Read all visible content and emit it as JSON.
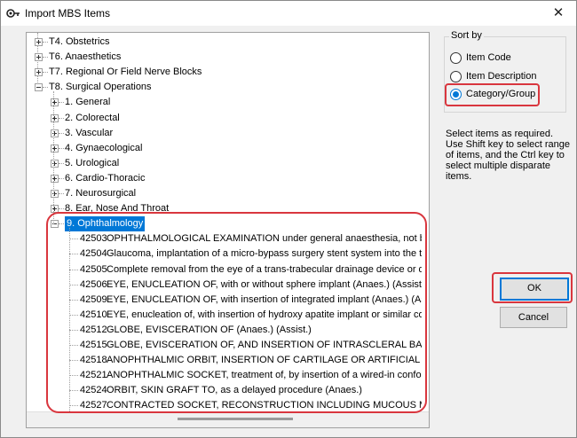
{
  "window": {
    "title": "Import MBS Items",
    "close_symbol": "✕",
    "icon": "app-logo-icon"
  },
  "tree": {
    "top_level": [
      {
        "label": "T4.  Obstetrics",
        "expanded": false
      },
      {
        "label": "T6.  Anaesthetics",
        "expanded": false
      },
      {
        "label": "T7.  Regional Or Field Nerve Blocks",
        "expanded": false
      },
      {
        "label": "T8.  Surgical Operations",
        "expanded": true
      }
    ],
    "sub_groups": [
      {
        "label": "1.  General",
        "expanded": false
      },
      {
        "label": "2.  Colorectal",
        "expanded": false
      },
      {
        "label": "3.  Vascular",
        "expanded": false
      },
      {
        "label": "4.  Gynaecological",
        "expanded": false
      },
      {
        "label": "5.  Urological",
        "expanded": false
      },
      {
        "label": "6.  Cardio-Thoracic",
        "expanded": false
      },
      {
        "label": "7.  Neurosurgical",
        "expanded": false
      },
      {
        "label": "8.  Ear, Nose And Throat",
        "expanded": false
      }
    ],
    "selected_group": {
      "label": "9.  Ophthalmology",
      "expanded": true
    },
    "items": [
      {
        "code": "42503",
        "description": "OPHTHALMOLOGICAL EXAMINATION under general anaesthesia, not being a service"
      },
      {
        "code": "42504",
        "description": "Glaucoma, implantation of a micro-bypass surgery stent system into the trabecular meshv"
      },
      {
        "code": "42505",
        "description": "Complete removal from the eye of a trans-trabecular drainage device or devices, with or"
      },
      {
        "code": "42506",
        "description": "EYE, ENUCLEATION OF, with or without sphere implant (Anaes.) (Assist.)"
      },
      {
        "code": "42509",
        "description": "EYE, ENUCLEATION OF, with insertion of integrated implant (Anaes.) (Assist.)"
      },
      {
        "code": "42510",
        "description": "EYE, enucleation of, with insertion of hydroxy apatite implant or similar coralline implant (/"
      },
      {
        "code": "42512",
        "description": "GLOBE, EVISCERATION OF (Anaes.) (Assist.)"
      },
      {
        "code": "42515",
        "description": "GLOBE, EVISCERATION OF, AND INSERTION OF INTRASCLERAL BALL OR CARTI"
      },
      {
        "code": "42518",
        "description": "ANOPHTHALMIC ORBIT, INSERTION OF CARTILAGE OR ARTIFICIAL IMPLANT as ."
      },
      {
        "code": "42521",
        "description": "ANOPHTHALMIC SOCKET, treatment of, by insertion of a wired-in conformer, integratec"
      },
      {
        "code": "42524",
        "description": "ORBIT, SKIN GRAFT TO, as a delayed procedure (Anaes.)"
      },
      {
        "code": "42527",
        "description": "CONTRACTED SOCKET, RECONSTRUCTION INCLUDING MUCOUS MEMBRANE G"
      }
    ]
  },
  "sort_by": {
    "title": "Sort by",
    "options": [
      {
        "label": "Item Code",
        "checked": false
      },
      {
        "label": "Item Description",
        "checked": false
      },
      {
        "label": "Category/Group",
        "checked": true
      }
    ]
  },
  "instructions": "Select items as required. Use Shift key to select range of items, and the Ctrl key to select multiple disparate items.",
  "buttons": {
    "ok": "OK",
    "cancel": "Cancel"
  },
  "colors": {
    "selection": "#0078d7",
    "annotation": "#d9363e"
  }
}
